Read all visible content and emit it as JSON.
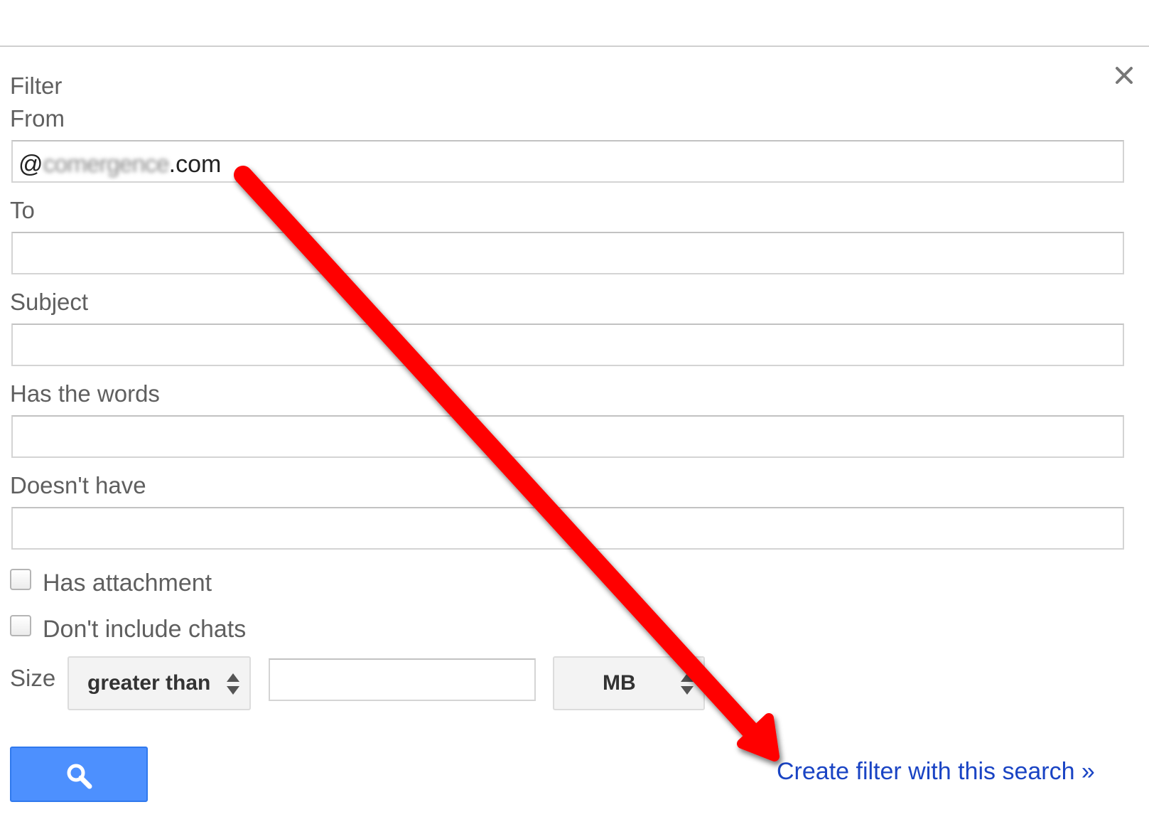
{
  "dialog": {
    "title": "Filter",
    "close_icon": "close-icon"
  },
  "fields": {
    "from": {
      "label": "From",
      "value_prefix": "@",
      "value_blurred": "comergence",
      "value_suffix": ".com"
    },
    "to": {
      "label": "To",
      "value": ""
    },
    "subject": {
      "label": "Subject",
      "value": ""
    },
    "has_words": {
      "label": "Has the words",
      "value": ""
    },
    "doesnt_have": {
      "label": "Doesn't have",
      "value": ""
    }
  },
  "checkboxes": {
    "has_attachment": {
      "label": "Has attachment",
      "checked": false
    },
    "no_chats": {
      "label": "Don't include chats",
      "checked": false
    }
  },
  "size": {
    "label": "Size",
    "comparator": "greater than",
    "value": "",
    "unit": "MB"
  },
  "actions": {
    "search_icon": "search-icon",
    "create_filter_label": "Create filter with this search »"
  },
  "annotation": {
    "arrow_color": "#ff0000"
  },
  "colors": {
    "button_blue": "#4d90fe",
    "link_blue": "#1a44c4",
    "label_gray": "#5f5f5f"
  }
}
